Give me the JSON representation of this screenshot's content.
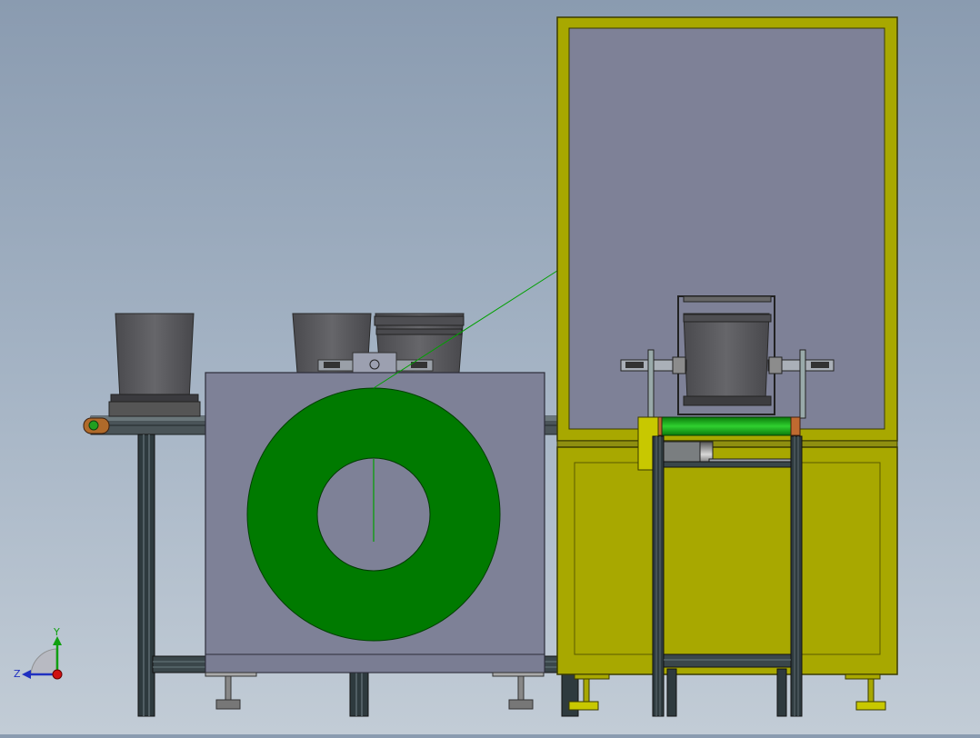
{
  "viewport": {
    "background_top": "#8a9bb0",
    "background_bottom": "#c2ccd6"
  },
  "colors": {
    "frame_yellow": "#a8a800",
    "frame_yellow_dark": "#6e6e00",
    "panel_gray": "#7e8197",
    "coil_green": "#007a00",
    "roller_green": "#20c020",
    "rail_dark": "#3b4448",
    "bucket_gray": "#5a5a5e",
    "pulley_orange": "#b06a2a"
  },
  "triad": {
    "y_label": "Y",
    "z_label": "Z",
    "icon": "coordinate-triad-icon"
  },
  "components": [
    "left-conveyor",
    "left-bucket",
    "center-machine-housing",
    "green-coil",
    "right-cabinet",
    "right-bucket",
    "green-roller"
  ]
}
